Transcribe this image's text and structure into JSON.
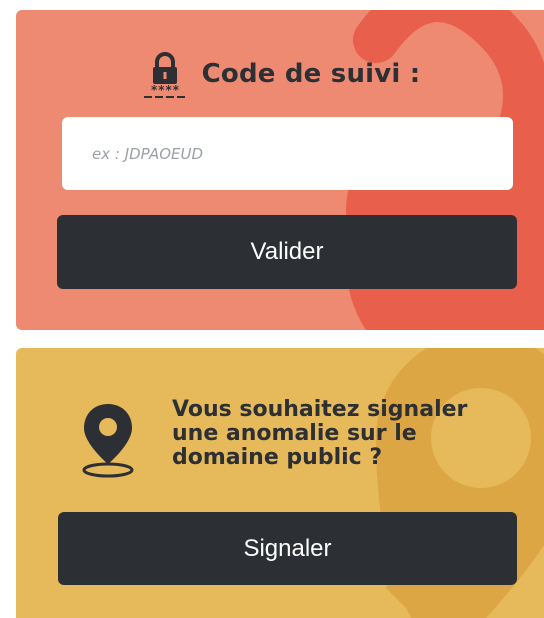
{
  "tracking": {
    "title": "Code de suivi :",
    "lock_stars": "****",
    "input_placeholder": "ex : JDPAOEUD",
    "input_value": "",
    "submit_label": "Valider"
  },
  "report": {
    "text_line1": "Vous souhaitez signaler",
    "text_line2": "une anomalie sur le",
    "text_line3": "domaine public ?",
    "button_label": "Signaler"
  },
  "colors": {
    "tracking_bg": "#ef8a72",
    "tracking_deco": "#e8604c",
    "report_bg": "#e6b95a",
    "report_deco": "#dda645",
    "button_bg": "#2c2f33",
    "text_dark": "#2c2f33"
  },
  "icons": {
    "tracking": "lock-icon",
    "report": "map-pin-icon"
  }
}
